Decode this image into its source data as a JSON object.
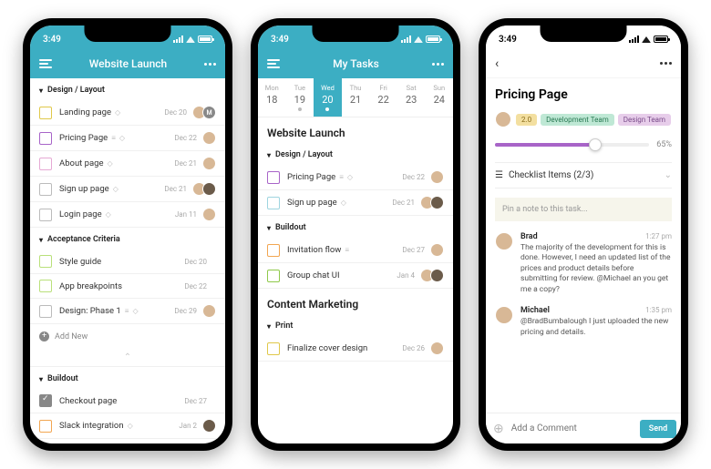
{
  "status_time": "3:49",
  "phone1": {
    "title": "Website Launch",
    "sections": [
      {
        "name": "Design / Layout",
        "tasks": [
          {
            "label": "Landing page",
            "date": "Dec 20",
            "color": "#e0c84a",
            "avatars": [
              "p",
              "M"
            ],
            "icons": [
              "comment"
            ]
          },
          {
            "label": "Pricing Page",
            "date": "Dec 22",
            "color": "#a864c8",
            "avatars": [
              "p"
            ],
            "icons": [
              "list",
              "comment"
            ]
          },
          {
            "label": "About page",
            "date": "Dec 21",
            "color": "#e6a9d4",
            "avatars": [
              "p"
            ],
            "icons": [
              "comment"
            ]
          },
          {
            "label": "Sign up page",
            "date": "Dec 21",
            "color": "#bbbbbb",
            "avatars": [
              "p",
              "d"
            ],
            "icons": [
              "comment"
            ]
          },
          {
            "label": "Login page",
            "date": "Jan 11",
            "color": "#bbbbbb",
            "avatars": [
              "p"
            ],
            "icons": [
              "comment"
            ]
          }
        ]
      },
      {
        "name": "Acceptance Criteria",
        "tasks": [
          {
            "label": "Style guide",
            "date": "Dec 20",
            "color": "#b9e07a",
            "avatars": []
          },
          {
            "label": "App breakpoints",
            "date": "Dec 22",
            "color": "#b9e07a",
            "avatars": []
          },
          {
            "label": "Design: Phase 1",
            "date": "Dec 29",
            "color": "#bbbbbb",
            "avatars": [
              "p"
            ],
            "icons": [
              "list",
              "comment"
            ]
          }
        ],
        "add_new": "Add New"
      },
      {
        "name": "Buildout",
        "tasks": [
          {
            "label": "Checkout page",
            "date": "Dec 27",
            "color": "#888888",
            "done": true,
            "avatars": []
          },
          {
            "label": "Slack integration",
            "date": "Jan 2",
            "color": "#f2a651",
            "avatars": [
              "d"
            ],
            "icons": [
              "comment"
            ]
          }
        ]
      }
    ]
  },
  "phone2": {
    "title": "My Tasks",
    "week": [
      {
        "d": "Mon",
        "n": "18"
      },
      {
        "d": "Tue",
        "n": "19",
        "dot": true
      },
      {
        "d": "Wed",
        "n": "20",
        "sel": true,
        "dot": true
      },
      {
        "d": "Thu",
        "n": "21"
      },
      {
        "d": "Fri",
        "n": "22"
      },
      {
        "d": "Sat",
        "n": "23"
      },
      {
        "d": "Sun",
        "n": "24"
      }
    ],
    "projects": [
      {
        "title": "Website Launch",
        "sections": [
          {
            "name": "Design / Layout",
            "tasks": [
              {
                "label": "Pricing Page",
                "date": "Dec 22",
                "color": "#a864c8",
                "avatars": [
                  "p"
                ],
                "icons": [
                  "list",
                  "comment"
                ]
              },
              {
                "label": "Sign up page",
                "date": "Dec 21",
                "color": "#9fd5e0",
                "avatars": [
                  "p",
                  "d"
                ],
                "icons": [
                  "comment"
                ]
              }
            ]
          },
          {
            "name": "Buildout",
            "tasks": [
              {
                "label": "Invitation flow",
                "date": "Dec 27",
                "color": "#f2a651",
                "avatars": [
                  "p"
                ],
                "icons": [
                  "list"
                ]
              },
              {
                "label": "Group chat UI",
                "date": "Jan 4",
                "color": "#8fc94a",
                "avatars": [
                  "p",
                  "d"
                ]
              }
            ]
          }
        ]
      },
      {
        "title": "Content Marketing",
        "sections": [
          {
            "name": "Print",
            "tasks": [
              {
                "label": "Finalize cover design",
                "date": "Dec 26",
                "color": "#e0c84a",
                "avatars": [
                  "p"
                ]
              }
            ]
          }
        ]
      }
    ]
  },
  "phone3": {
    "title": "Pricing Page",
    "tags": [
      {
        "label": "2.0",
        "bg": "#f3dfa0",
        "fg": "#8a6d1a"
      },
      {
        "label": "Development Team",
        "bg": "#bfe8d5",
        "fg": "#2a7a54"
      },
      {
        "label": "Design Team",
        "bg": "#e7cdea",
        "fg": "#7a4c8a"
      }
    ],
    "progress": 65,
    "checklist": {
      "label": "Checklist Items",
      "count": "(2/3)"
    },
    "pin_placeholder": "Pin a note to this task...",
    "comments": [
      {
        "name": "Brad",
        "time": "1:27 pm",
        "text": "The majority of the development for this is done. However, I need an updated list of the prices and product details before submitting for review. @Michael an you get me a copy?"
      },
      {
        "name": "Michael",
        "time": "1:35 pm",
        "text": "@BradBumbalough I just uploaded the new pricing and details."
      }
    ],
    "comment_placeholder": "Add a Comment",
    "send": "Send"
  }
}
